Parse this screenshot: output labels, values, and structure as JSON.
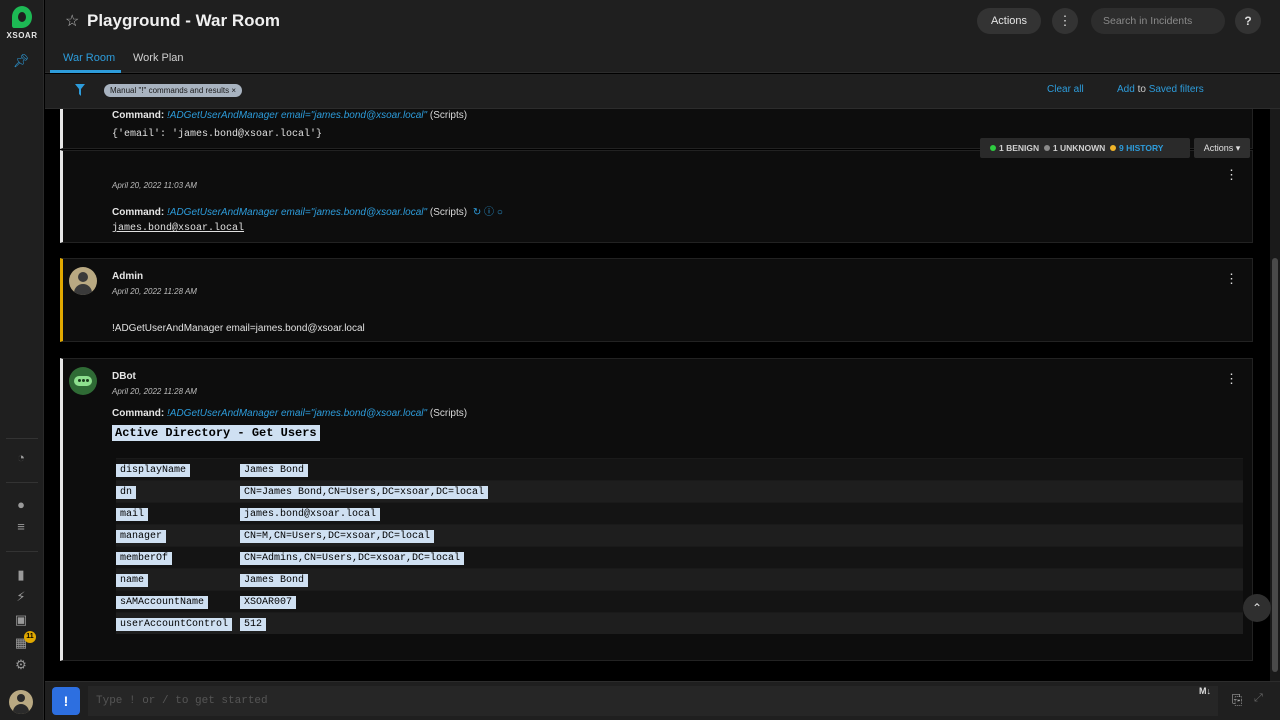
{
  "app": {
    "logo_text": "XSOAR"
  },
  "header": {
    "title": "Playground - War Room",
    "actions_label": "Actions",
    "search_placeholder": "Search in Incidents",
    "help_label": "?"
  },
  "tabs": [
    {
      "label": "War Room",
      "active": true
    },
    {
      "label": "Work Plan",
      "active": false
    }
  ],
  "filters": {
    "chip_label": "Manual \"!\" commands and results",
    "clear_all": "Clear all",
    "add_label": "Add",
    "to_label": "to",
    "saved_filters": "Saved filters"
  },
  "status": {
    "benign": "1 BENIGN",
    "unknown": "1 UNKNOWN",
    "history": "9 HISTORY",
    "actions_label": "Actions"
  },
  "colors": {
    "accent": "#2d9cdb",
    "benign": "#2ecc40",
    "unknown": "#8a8a8a",
    "history": "#f0b429",
    "admin_border": "#e0a800"
  },
  "entries": {
    "first": {
      "command_label": "Command:",
      "command": "!ADGetUserAndManager email=\"james.bond@xsoar.local\"",
      "source": "(Scripts)",
      "output": "{'email': 'james.bond@xsoar.local'}"
    },
    "second": {
      "timestamp": "April 20, 2022 11:03 AM",
      "command_label": "Command:",
      "command": "!ADGetUserAndManager email=\"james.bond@xsoar.local\"",
      "source": "(Scripts)",
      "output": "james.bond@xsoar.local"
    },
    "admin": {
      "author": "Admin",
      "timestamp": "April 20, 2022 11:28 AM",
      "message": "!ADGetUserAndManager email=james.bond@xsoar.local"
    },
    "dbot": {
      "author": "DBot",
      "timestamp": "April 20, 2022 11:28 AM",
      "command_label": "Command:",
      "command": "!ADGetUserAndManager email=\"james.bond@xsoar.local\"",
      "source": "(Scripts)",
      "table_title": "Active Directory - Get Users",
      "rows": [
        {
          "key": "displayName",
          "value": "James Bond"
        },
        {
          "key": "dn",
          "value": "CN=James Bond,CN=Users,DC=xsoar,DC=local"
        },
        {
          "key": "mail",
          "value": "james.bond@xsoar.local"
        },
        {
          "key": "manager",
          "value": "CN=M,CN=Users,DC=xsoar,DC=local"
        },
        {
          "key": "memberOf",
          "value": "CN=Admins,CN=Users,DC=xsoar,DC=local"
        },
        {
          "key": "name",
          "value": "James Bond"
        },
        {
          "key": "sAMAccountName",
          "value": "XSOAR007"
        },
        {
          "key": "userAccountControl",
          "value": "512"
        }
      ]
    }
  },
  "composer": {
    "placeholder": "Type ! or / to get started",
    "markdown_label": "M↓"
  },
  "rail": {
    "badge_count": "11"
  }
}
